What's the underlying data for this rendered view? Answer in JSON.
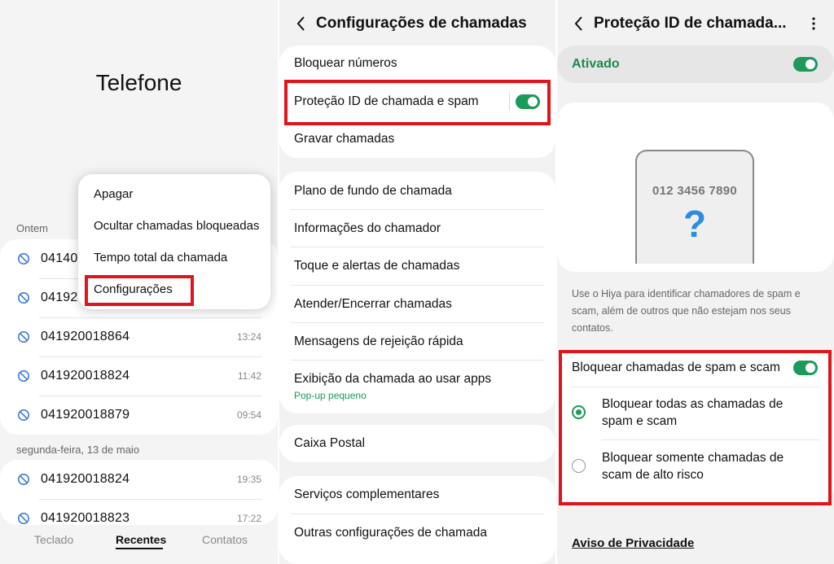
{
  "panel1": {
    "title": "Telefone",
    "yesterday_label": "Ontem",
    "calls_yesterday": [
      {
        "number": "04140",
        "time": ""
      },
      {
        "number": "04192",
        "time": ""
      },
      {
        "number": "041920018864",
        "time": "13:24"
      },
      {
        "number": "041920018824",
        "time": "11:42"
      },
      {
        "number": "041920018879",
        "time": "09:54"
      }
    ],
    "monday_label": "segunda-feira, 13 de maio",
    "calls_monday": [
      {
        "number": "041920018824",
        "time": "19:35"
      },
      {
        "number": "041920018823",
        "time": "17:22"
      }
    ],
    "popup_menu": [
      "Apagar",
      "Ocultar chamadas bloqueadas",
      "Tempo total da chamada",
      "Configurações"
    ],
    "tabs": [
      "Teclado",
      "Recentes",
      "Contatos"
    ],
    "active_tab": "Recentes"
  },
  "panel2": {
    "title": "Configurações de chamadas",
    "group1": [
      "Bloquear números",
      "Proteção ID de chamada e spam",
      "Gravar chamadas"
    ],
    "caller_id_toggle": true,
    "group2": [
      "Plano de fundo de chamada",
      "Informações do chamador",
      "Toque e alertas de chamadas",
      "Atender/Encerrar chamadas",
      "Mensagens de rejeição rápida",
      "Exibição da chamada ao usar apps"
    ],
    "group2_sub": "Pop-up pequeno",
    "group3": [
      "Caixa Postal"
    ],
    "group4": [
      "Serviços complementares",
      "Outras configurações de chamada"
    ]
  },
  "panel3": {
    "title": "Proteção ID de chamada...",
    "status": "Ativado",
    "status_toggle": true,
    "phone_number": "012 3456 7890",
    "phone_mark": "?",
    "description": "Use o Hiya para identificar chamadores de spam e scam, além de outros que não estejam nos seus contatos.",
    "block_label": "Bloquear chamadas de spam e scam",
    "block_toggle": true,
    "options": [
      "Bloquear todas as chamadas de spam e scam",
      "Bloquear somente chamadas de scam de alto risco"
    ],
    "selected_option": 0,
    "privacy": "Aviso de Privacidade"
  },
  "colors": {
    "accent_green": "#1c9a5a",
    "highlight_red": "#e0141b",
    "question_blue": "#2a8de3"
  }
}
